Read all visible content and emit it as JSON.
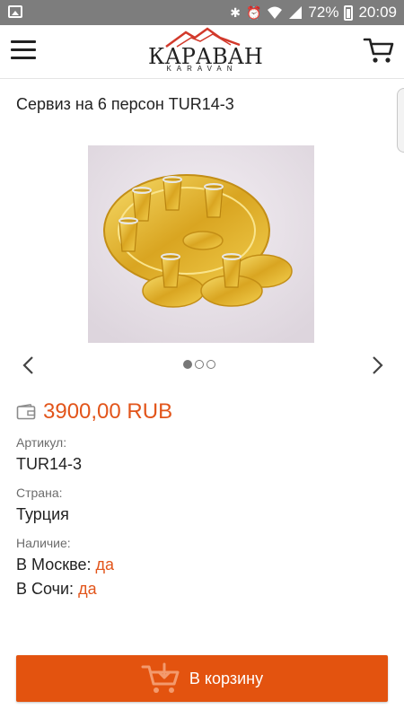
{
  "status_bar": {
    "battery_percent": "72%",
    "time": "20:09",
    "icons": [
      "gallery-notification-icon",
      "bluetooth-icon",
      "alarm-icon",
      "wifi-icon",
      "signal-icon",
      "battery-icon"
    ]
  },
  "header": {
    "logo_text": "КАРАВАН",
    "logo_subtext": "KARAVAN"
  },
  "product": {
    "title": "Сервиз на 6 персон TUR14-3",
    "image_alt": "Золотой чайный сервиз на подносе",
    "gallery": {
      "total": 3,
      "active_index": 0
    },
    "price": "3900,00 RUB",
    "sku_label": "Артикул:",
    "sku_value": "TUR14-3",
    "country_label": "Страна:",
    "country_value": "Турция",
    "availability_label": "Наличие:",
    "moscow_label": "В Москве:",
    "moscow_value": "да",
    "sochi_label": "В Сочи:",
    "sochi_value": "да"
  },
  "actions": {
    "add_to_cart": "В корзину"
  },
  "colors": {
    "accent": "#e2551b",
    "button": "#e3530f",
    "status_bar": "#7d7d7d"
  }
}
